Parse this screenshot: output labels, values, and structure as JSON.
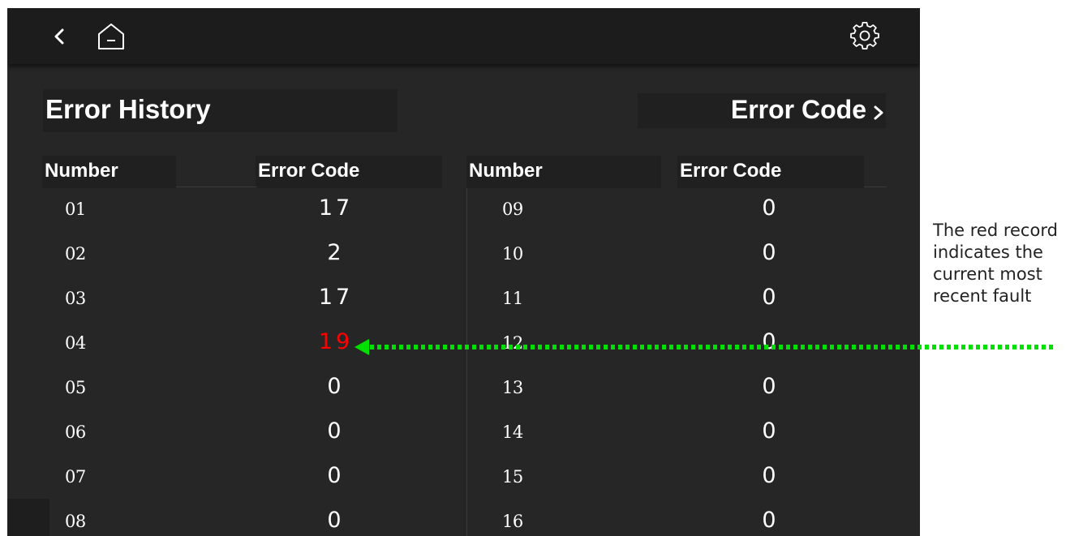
{
  "header": {
    "back_icon": "chevron-left-icon",
    "home_icon": "home-icon",
    "settings_icon": "gear-icon"
  },
  "page": {
    "title": "Error History",
    "link_label": "Error Code",
    "link_icon": "chevron-right-icon"
  },
  "table": {
    "left_headers": {
      "number": "Number",
      "code": "Error Code"
    },
    "right_headers": {
      "number": "Number",
      "code": "Error Code"
    },
    "left_rows": [
      {
        "number": "01",
        "code": "17"
      },
      {
        "number": "02",
        "code": "2"
      },
      {
        "number": "03",
        "code": "17"
      },
      {
        "number": "04",
        "code": "19"
      },
      {
        "number": "05",
        "code": "0"
      },
      {
        "number": "06",
        "code": "0"
      },
      {
        "number": "07",
        "code": "0"
      },
      {
        "number": "08",
        "code": "0"
      }
    ],
    "right_rows": [
      {
        "number": "09",
        "code": "0"
      },
      {
        "number": "10",
        "code": "0"
      },
      {
        "number": "11",
        "code": "0"
      },
      {
        "number": "12",
        "code": "0"
      },
      {
        "number": "13",
        "code": "0"
      },
      {
        "number": "14",
        "code": "0"
      },
      {
        "number": "15",
        "code": "0"
      },
      {
        "number": "16",
        "code": "0"
      }
    ],
    "highlight_color": "#ff0000",
    "text_color": "#ffffff"
  },
  "annotation": {
    "lines": [
      "The red record",
      "indicates the",
      "current most",
      "recent fault"
    ],
    "arrow_color": "#00e000"
  }
}
